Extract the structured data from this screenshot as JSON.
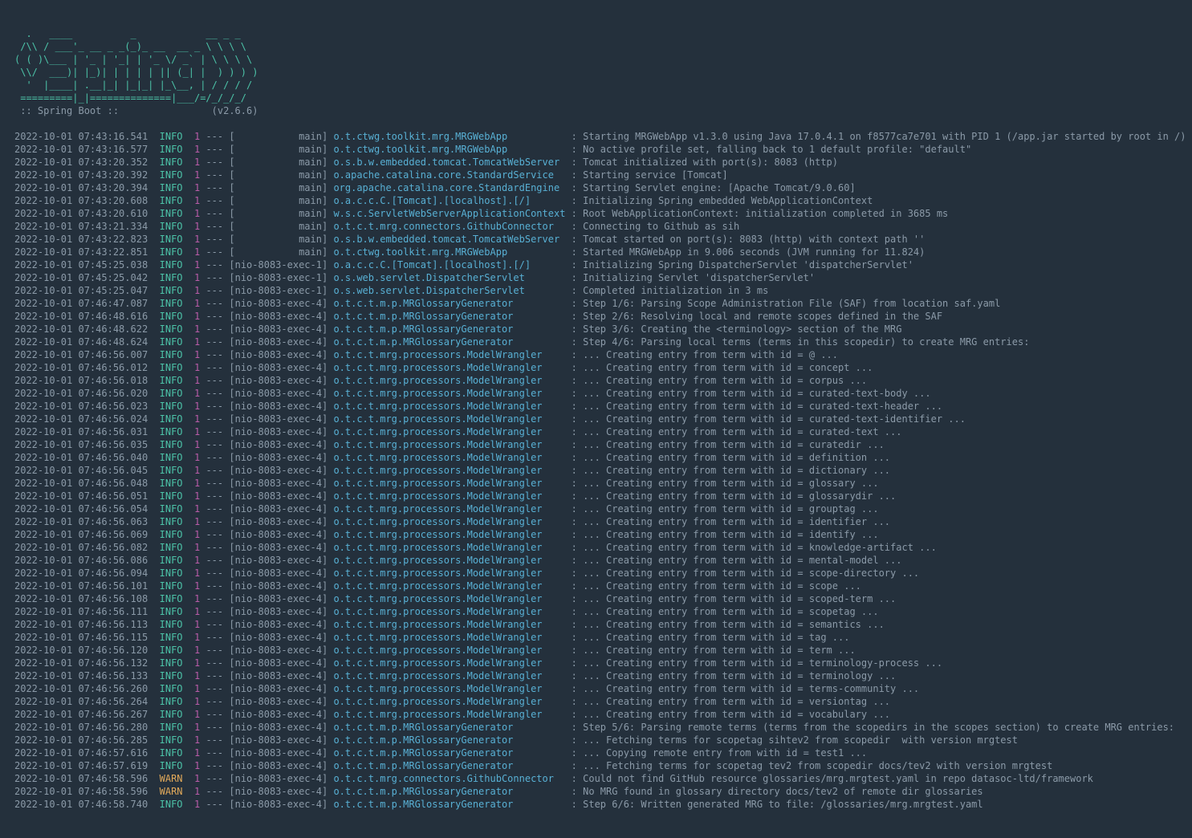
{
  "ascii_art": "  .   ____          _            __ _ _\n /\\\\ / ___'_ __ _ _(_)_ __  __ _ \\ \\ \\ \\\n( ( )\\___ | '_ | '_| | '_ \\/ _` | \\ \\ \\ \\\n \\\\/  ___)| |_)| | | | | || (_| |  ) ) ) )\n  '  |____| .__|_| |_|_| |_\\__, | / / / /\n =========|_|==============|___/=/_/_/_/",
  "boot_label": " :: Spring Boot :: ",
  "boot_version": "(v2.6.6)",
  "logs": [
    {
      "ts": "2022-10-01 07:43:16.541",
      "lv": "INFO",
      "pid": "1",
      "thr": "main",
      "logger": "o.t.ctwg.toolkit.mrg.MRGWebApp",
      "msg": "Starting MRGWebApp v1.3.0 using Java 17.0.4.1 on f8577ca7e701 with PID 1 (/app.jar started by root in /)"
    },
    {
      "ts": "2022-10-01 07:43:16.577",
      "lv": "INFO",
      "pid": "1",
      "thr": "main",
      "logger": "o.t.ctwg.toolkit.mrg.MRGWebApp",
      "msg": "No active profile set, falling back to 1 default profile: \"default\""
    },
    {
      "ts": "2022-10-01 07:43:20.352",
      "lv": "INFO",
      "pid": "1",
      "thr": "main",
      "logger": "o.s.b.w.embedded.tomcat.TomcatWebServer",
      "msg": "Tomcat initialized with port(s): 8083 (http)"
    },
    {
      "ts": "2022-10-01 07:43:20.392",
      "lv": "INFO",
      "pid": "1",
      "thr": "main",
      "logger": "o.apache.catalina.core.StandardService",
      "msg": "Starting service [Tomcat]"
    },
    {
      "ts": "2022-10-01 07:43:20.394",
      "lv": "INFO",
      "pid": "1",
      "thr": "main",
      "logger": "org.apache.catalina.core.StandardEngine",
      "msg": "Starting Servlet engine: [Apache Tomcat/9.0.60]"
    },
    {
      "ts": "2022-10-01 07:43:20.608",
      "lv": "INFO",
      "pid": "1",
      "thr": "main",
      "logger": "o.a.c.c.C.[Tomcat].[localhost].[/]",
      "msg": "Initializing Spring embedded WebApplicationContext"
    },
    {
      "ts": "2022-10-01 07:43:20.610",
      "lv": "INFO",
      "pid": "1",
      "thr": "main",
      "logger": "w.s.c.ServletWebServerApplicationContext",
      "msg": "Root WebApplicationContext: initialization completed in 3685 ms"
    },
    {
      "ts": "2022-10-01 07:43:21.334",
      "lv": "INFO",
      "pid": "1",
      "thr": "main",
      "logger": "o.t.c.t.mrg.connectors.GithubConnector",
      "msg": "Connecting to Github as sih"
    },
    {
      "ts": "2022-10-01 07:43:22.823",
      "lv": "INFO",
      "pid": "1",
      "thr": "main",
      "logger": "o.s.b.w.embedded.tomcat.TomcatWebServer",
      "msg": "Tomcat started on port(s): 8083 (http) with context path ''"
    },
    {
      "ts": "2022-10-01 07:43:22.851",
      "lv": "INFO",
      "pid": "1",
      "thr": "main",
      "logger": "o.t.ctwg.toolkit.mrg.MRGWebApp",
      "msg": "Started MRGWebApp in 9.006 seconds (JVM running for 11.824)"
    },
    {
      "ts": "2022-10-01 07:45:25.038",
      "lv": "INFO",
      "pid": "1",
      "thr": "nio-8083-exec-1",
      "logger": "o.a.c.c.C.[Tomcat].[localhost].[/]",
      "msg": "Initializing Spring DispatcherServlet 'dispatcherServlet'"
    },
    {
      "ts": "2022-10-01 07:45:25.042",
      "lv": "INFO",
      "pid": "1",
      "thr": "nio-8083-exec-1",
      "logger": "o.s.web.servlet.DispatcherServlet",
      "msg": "Initializing Servlet 'dispatcherServlet'"
    },
    {
      "ts": "2022-10-01 07:45:25.047",
      "lv": "INFO",
      "pid": "1",
      "thr": "nio-8083-exec-1",
      "logger": "o.s.web.servlet.DispatcherServlet",
      "msg": "Completed initialization in 3 ms"
    },
    {
      "ts": "2022-10-01 07:46:47.087",
      "lv": "INFO",
      "pid": "1",
      "thr": "nio-8083-exec-4",
      "logger": "o.t.c.t.m.p.MRGlossaryGenerator",
      "msg": "Step 1/6: Parsing Scope Administration File (SAF) from location saf.yaml"
    },
    {
      "ts": "2022-10-01 07:46:48.616",
      "lv": "INFO",
      "pid": "1",
      "thr": "nio-8083-exec-4",
      "logger": "o.t.c.t.m.p.MRGlossaryGenerator",
      "msg": "Step 2/6: Resolving local and remote scopes defined in the SAF"
    },
    {
      "ts": "2022-10-01 07:46:48.622",
      "lv": "INFO",
      "pid": "1",
      "thr": "nio-8083-exec-4",
      "logger": "o.t.c.t.m.p.MRGlossaryGenerator",
      "msg": "Step 3/6: Creating the <terminology> section of the MRG"
    },
    {
      "ts": "2022-10-01 07:46:48.624",
      "lv": "INFO",
      "pid": "1",
      "thr": "nio-8083-exec-4",
      "logger": "o.t.c.t.m.p.MRGlossaryGenerator",
      "msg": "Step 4/6: Parsing local terms (terms in this scopedir) to create MRG entries:"
    },
    {
      "ts": "2022-10-01 07:46:56.007",
      "lv": "INFO",
      "pid": "1",
      "thr": "nio-8083-exec-4",
      "logger": "o.t.c.t.mrg.processors.ModelWrangler",
      "msg": "... Creating entry from term with id = @ ..."
    },
    {
      "ts": "2022-10-01 07:46:56.012",
      "lv": "INFO",
      "pid": "1",
      "thr": "nio-8083-exec-4",
      "logger": "o.t.c.t.mrg.processors.ModelWrangler",
      "msg": "... Creating entry from term with id = concept ..."
    },
    {
      "ts": "2022-10-01 07:46:56.018",
      "lv": "INFO",
      "pid": "1",
      "thr": "nio-8083-exec-4",
      "logger": "o.t.c.t.mrg.processors.ModelWrangler",
      "msg": "... Creating entry from term with id = corpus ..."
    },
    {
      "ts": "2022-10-01 07:46:56.020",
      "lv": "INFO",
      "pid": "1",
      "thr": "nio-8083-exec-4",
      "logger": "o.t.c.t.mrg.processors.ModelWrangler",
      "msg": "... Creating entry from term with id = curated-text-body ..."
    },
    {
      "ts": "2022-10-01 07:46:56.023",
      "lv": "INFO",
      "pid": "1",
      "thr": "nio-8083-exec-4",
      "logger": "o.t.c.t.mrg.processors.ModelWrangler",
      "msg": "... Creating entry from term with id = curated-text-header ..."
    },
    {
      "ts": "2022-10-01 07:46:56.024",
      "lv": "INFO",
      "pid": "1",
      "thr": "nio-8083-exec-4",
      "logger": "o.t.c.t.mrg.processors.ModelWrangler",
      "msg": "... Creating entry from term with id = curated-text-identifier ..."
    },
    {
      "ts": "2022-10-01 07:46:56.031",
      "lv": "INFO",
      "pid": "1",
      "thr": "nio-8083-exec-4",
      "logger": "o.t.c.t.mrg.processors.ModelWrangler",
      "msg": "... Creating entry from term with id = curated-text ..."
    },
    {
      "ts": "2022-10-01 07:46:56.035",
      "lv": "INFO",
      "pid": "1",
      "thr": "nio-8083-exec-4",
      "logger": "o.t.c.t.mrg.processors.ModelWrangler",
      "msg": "... Creating entry from term with id = curatedir ..."
    },
    {
      "ts": "2022-10-01 07:46:56.040",
      "lv": "INFO",
      "pid": "1",
      "thr": "nio-8083-exec-4",
      "logger": "o.t.c.t.mrg.processors.ModelWrangler",
      "msg": "... Creating entry from term with id = definition ..."
    },
    {
      "ts": "2022-10-01 07:46:56.045",
      "lv": "INFO",
      "pid": "1",
      "thr": "nio-8083-exec-4",
      "logger": "o.t.c.t.mrg.processors.ModelWrangler",
      "msg": "... Creating entry from term with id = dictionary ..."
    },
    {
      "ts": "2022-10-01 07:46:56.048",
      "lv": "INFO",
      "pid": "1",
      "thr": "nio-8083-exec-4",
      "logger": "o.t.c.t.mrg.processors.ModelWrangler",
      "msg": "... Creating entry from term with id = glossary ..."
    },
    {
      "ts": "2022-10-01 07:46:56.051",
      "lv": "INFO",
      "pid": "1",
      "thr": "nio-8083-exec-4",
      "logger": "o.t.c.t.mrg.processors.ModelWrangler",
      "msg": "... Creating entry from term with id = glossarydir ..."
    },
    {
      "ts": "2022-10-01 07:46:56.054",
      "lv": "INFO",
      "pid": "1",
      "thr": "nio-8083-exec-4",
      "logger": "o.t.c.t.mrg.processors.ModelWrangler",
      "msg": "... Creating entry from term with id = grouptag ..."
    },
    {
      "ts": "2022-10-01 07:46:56.063",
      "lv": "INFO",
      "pid": "1",
      "thr": "nio-8083-exec-4",
      "logger": "o.t.c.t.mrg.processors.ModelWrangler",
      "msg": "... Creating entry from term with id = identifier ..."
    },
    {
      "ts": "2022-10-01 07:46:56.069",
      "lv": "INFO",
      "pid": "1",
      "thr": "nio-8083-exec-4",
      "logger": "o.t.c.t.mrg.processors.ModelWrangler",
      "msg": "... Creating entry from term with id = identify ..."
    },
    {
      "ts": "2022-10-01 07:46:56.082",
      "lv": "INFO",
      "pid": "1",
      "thr": "nio-8083-exec-4",
      "logger": "o.t.c.t.mrg.processors.ModelWrangler",
      "msg": "... Creating entry from term with id = knowledge-artifact ..."
    },
    {
      "ts": "2022-10-01 07:46:56.086",
      "lv": "INFO",
      "pid": "1",
      "thr": "nio-8083-exec-4",
      "logger": "o.t.c.t.mrg.processors.ModelWrangler",
      "msg": "... Creating entry from term with id = mental-model ..."
    },
    {
      "ts": "2022-10-01 07:46:56.094",
      "lv": "INFO",
      "pid": "1",
      "thr": "nio-8083-exec-4",
      "logger": "o.t.c.t.mrg.processors.ModelWrangler",
      "msg": "... Creating entry from term with id = scope-directory ..."
    },
    {
      "ts": "2022-10-01 07:46:56.101",
      "lv": "INFO",
      "pid": "1",
      "thr": "nio-8083-exec-4",
      "logger": "o.t.c.t.mrg.processors.ModelWrangler",
      "msg": "... Creating entry from term with id = scope ..."
    },
    {
      "ts": "2022-10-01 07:46:56.108",
      "lv": "INFO",
      "pid": "1",
      "thr": "nio-8083-exec-4",
      "logger": "o.t.c.t.mrg.processors.ModelWrangler",
      "msg": "... Creating entry from term with id = scoped-term ..."
    },
    {
      "ts": "2022-10-01 07:46:56.111",
      "lv": "INFO",
      "pid": "1",
      "thr": "nio-8083-exec-4",
      "logger": "o.t.c.t.mrg.processors.ModelWrangler",
      "msg": "... Creating entry from term with id = scopetag ..."
    },
    {
      "ts": "2022-10-01 07:46:56.113",
      "lv": "INFO",
      "pid": "1",
      "thr": "nio-8083-exec-4",
      "logger": "o.t.c.t.mrg.processors.ModelWrangler",
      "msg": "... Creating entry from term with id = semantics ..."
    },
    {
      "ts": "2022-10-01 07:46:56.115",
      "lv": "INFO",
      "pid": "1",
      "thr": "nio-8083-exec-4",
      "logger": "o.t.c.t.mrg.processors.ModelWrangler",
      "msg": "... Creating entry from term with id = tag ..."
    },
    {
      "ts": "2022-10-01 07:46:56.120",
      "lv": "INFO",
      "pid": "1",
      "thr": "nio-8083-exec-4",
      "logger": "o.t.c.t.mrg.processors.ModelWrangler",
      "msg": "... Creating entry from term with id = term ..."
    },
    {
      "ts": "2022-10-01 07:46:56.132",
      "lv": "INFO",
      "pid": "1",
      "thr": "nio-8083-exec-4",
      "logger": "o.t.c.t.mrg.processors.ModelWrangler",
      "msg": "... Creating entry from term with id = terminology-process ..."
    },
    {
      "ts": "2022-10-01 07:46:56.133",
      "lv": "INFO",
      "pid": "1",
      "thr": "nio-8083-exec-4",
      "logger": "o.t.c.t.mrg.processors.ModelWrangler",
      "msg": "... Creating entry from term with id = terminology ..."
    },
    {
      "ts": "2022-10-01 07:46:56.260",
      "lv": "INFO",
      "pid": "1",
      "thr": "nio-8083-exec-4",
      "logger": "o.t.c.t.mrg.processors.ModelWrangler",
      "msg": "... Creating entry from term with id = terms-community ..."
    },
    {
      "ts": "2022-10-01 07:46:56.264",
      "lv": "INFO",
      "pid": "1",
      "thr": "nio-8083-exec-4",
      "logger": "o.t.c.t.mrg.processors.ModelWrangler",
      "msg": "... Creating entry from term with id = versiontag ..."
    },
    {
      "ts": "2022-10-01 07:46:56.267",
      "lv": "INFO",
      "pid": "1",
      "thr": "nio-8083-exec-4",
      "logger": "o.t.c.t.mrg.processors.ModelWrangler",
      "msg": "... Creating entry from term with id = vocabulary ..."
    },
    {
      "ts": "2022-10-01 07:46:56.280",
      "lv": "INFO",
      "pid": "1",
      "thr": "nio-8083-exec-4",
      "logger": "o.t.c.t.m.p.MRGlossaryGenerator",
      "msg": "Step 5/6: Parsing remote terms (terms from the scopedirs in the scopes section) to create MRG entries:"
    },
    {
      "ts": "2022-10-01 07:46:56.285",
      "lv": "INFO",
      "pid": "1",
      "thr": "nio-8083-exec-4",
      "logger": "o.t.c.t.m.p.MRGlossaryGenerator",
      "msg": "... Fetching terms for scopetag sihtev2 from scopedir  with version mrgtest"
    },
    {
      "ts": "2022-10-01 07:46:57.616",
      "lv": "INFO",
      "pid": "1",
      "thr": "nio-8083-exec-4",
      "logger": "o.t.c.t.m.p.MRGlossaryGenerator",
      "msg": "... Copying remote entry from with id = test1 ..."
    },
    {
      "ts": "2022-10-01 07:46:57.619",
      "lv": "INFO",
      "pid": "1",
      "thr": "nio-8083-exec-4",
      "logger": "o.t.c.t.m.p.MRGlossaryGenerator",
      "msg": "... Fetching terms for scopetag tev2 from scopedir docs/tev2 with version mrgtest"
    },
    {
      "ts": "2022-10-01 07:46:58.596",
      "lv": "WARN",
      "pid": "1",
      "thr": "nio-8083-exec-4",
      "logger": "o.t.c.t.mrg.connectors.GithubConnector",
      "msg": "Could not find GitHub resource glossaries/mrg.mrgtest.yaml in repo datasoc-ltd/framework"
    },
    {
      "ts": "2022-10-01 07:46:58.596",
      "lv": "WARN",
      "pid": "1",
      "thr": "nio-8083-exec-4",
      "logger": "o.t.c.t.m.p.MRGlossaryGenerator",
      "msg": "No MRG found in glossary directory docs/tev2 of remote dir glossaries"
    },
    {
      "ts": "2022-10-01 07:46:58.740",
      "lv": "INFO",
      "pid": "1",
      "thr": "nio-8083-exec-4",
      "logger": "o.t.c.t.m.p.MRGlossaryGenerator",
      "msg": "Step 6/6: Written generated MRG to file: /glossaries/mrg.mrgtest.yaml"
    }
  ]
}
